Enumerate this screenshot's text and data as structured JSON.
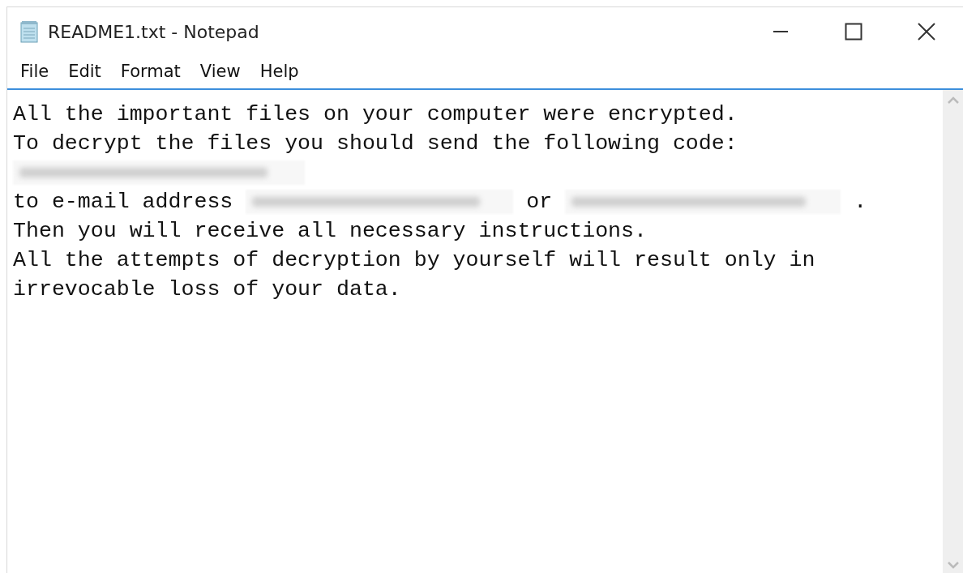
{
  "window": {
    "title": "README1.txt - Notepad"
  },
  "menu": [
    {
      "label": "File"
    },
    {
      "label": "Edit"
    },
    {
      "label": "Format"
    },
    {
      "label": "View"
    },
    {
      "label": "Help"
    }
  ],
  "document": {
    "lines": [
      [
        {
          "kind": "text",
          "text": "All the important files on your computer were encrypted."
        }
      ],
      [
        {
          "kind": "text",
          "text": "To decrypt the files you should send the following code:"
        }
      ],
      [
        {
          "kind": "redacted"
        }
      ],
      [
        {
          "kind": "text",
          "text": "to e-mail address"
        },
        {
          "kind": "redacted"
        },
        {
          "kind": "text",
          "text": "or"
        },
        {
          "kind": "redacted"
        },
        {
          "kind": "text",
          "text": "."
        }
      ],
      [
        {
          "kind": "text",
          "text": "Then you will receive all necessary instructions."
        }
      ],
      [
        {
          "kind": "text",
          "text": "All the attempts of decryption by yourself will result only in"
        }
      ],
      [
        {
          "kind": "text",
          "text": "irrevocable loss of your data."
        }
      ]
    ]
  }
}
